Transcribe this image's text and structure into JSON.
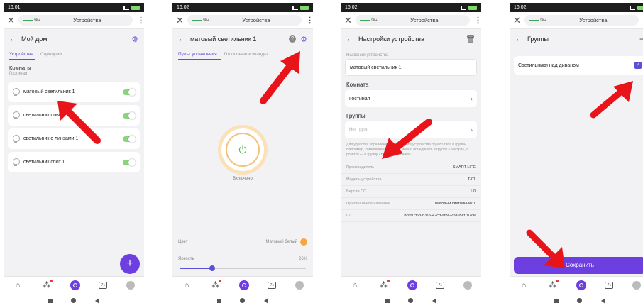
{
  "status_times": [
    "16:01",
    "16:02",
    "16:02",
    "16:02"
  ],
  "url_bar": {
    "title": "Устройства",
    "badge": "9К+"
  },
  "screen1": {
    "title": "Мой дом",
    "tabs": [
      "Устройства",
      "Сценарии"
    ],
    "section": "Комнаты",
    "subsection": "Гостиная",
    "devices": [
      "матовый светильник 1",
      "светильник повор… 1",
      "светильник с линзами 1",
      "светильник спот 1"
    ],
    "fab": "+"
  },
  "screen2": {
    "title": "матовый светильник 1",
    "tabs": [
      "Пульт управления",
      "Голосовые команды"
    ],
    "power_state": "Включено",
    "color_label": "Цвет",
    "color_value": "Матовый белый",
    "brightness_label": "Яркость",
    "brightness_value": "26%",
    "brightness_fraction": 0.26
  },
  "screen3": {
    "title": "Настройки устройства",
    "name_label": "Название устройства",
    "name_value": "матовый светильник 1",
    "room_label": "Комната",
    "room_value": "Гостиная",
    "groups_label": "Группы",
    "groups_value": "Нет групп",
    "hint": "Для удобства управления объединяйте устройства одного типа в группы. Например, камелечки из люстры можно объединить в группу «Люстра», а розетки — в группу «Бытовая техника».",
    "info": [
      {
        "k": "Производитель",
        "v": "SMART LIFE"
      },
      {
        "k": "Модель устройства",
        "v": "T-01"
      },
      {
        "k": "Версия ПО",
        "v": "1.0"
      },
      {
        "k": "Оригинальное название",
        "v": "матовый светильник 1"
      },
      {
        "k": "ID",
        "v": "bc6f1cf63-b316-42cd-afba-2ba95cf707ce"
      }
    ]
  },
  "screen4": {
    "title": "Группы",
    "group_name": "Светильники над диваном",
    "save_label": "Сохранить"
  },
  "nav": {
    "tv_label": "71"
  },
  "colors": {
    "accent": "#6d3fe0",
    "toggle_on": "#89d67a",
    "arrow": "#e8141a"
  }
}
